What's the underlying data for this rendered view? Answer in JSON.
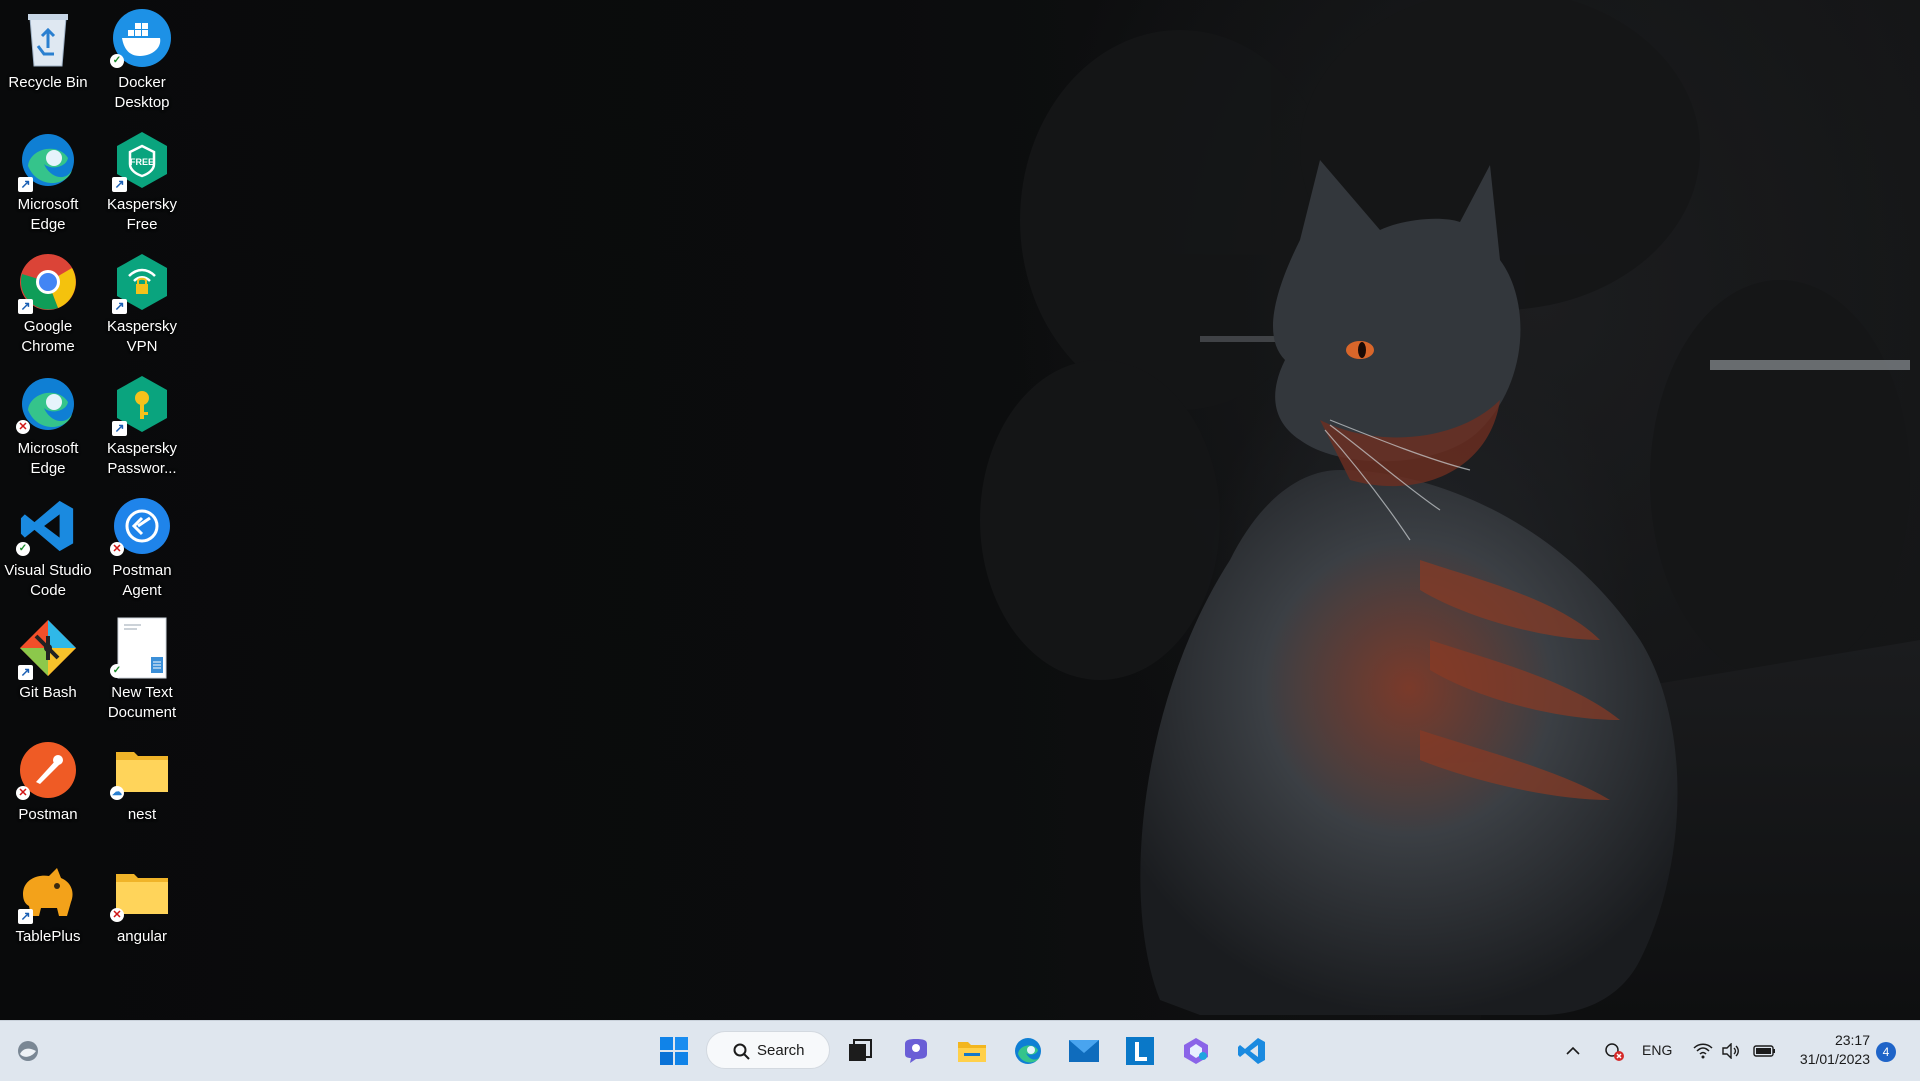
{
  "desktop_icons": [
    {
      "label": "Recycle Bin",
      "icon": "recycle-bin-icon",
      "badge": null
    },
    {
      "label": "Docker Desktop",
      "icon": "docker-icon",
      "badge": "ok"
    },
    {
      "label": "Microsoft Edge",
      "icon": "edge-icon",
      "badge": "shortcut"
    },
    {
      "label": "Kaspersky Free",
      "icon": "kaspersky-free-icon",
      "badge": "shortcut"
    },
    {
      "label": "Google Chrome",
      "icon": "chrome-icon",
      "badge": "shortcut"
    },
    {
      "label": "Kaspersky VPN",
      "icon": "kaspersky-vpn-icon",
      "badge": "shortcut"
    },
    {
      "label": "Microsoft Edge",
      "icon": "edge-icon",
      "badge": "error"
    },
    {
      "label": "Kaspersky Passwor...",
      "icon": "kaspersky-password-icon",
      "badge": "shortcut"
    },
    {
      "label": "Visual Studio Code",
      "icon": "vscode-icon",
      "badge": "ok"
    },
    {
      "label": "Postman Agent",
      "icon": "postman-agent-icon",
      "badge": "error"
    },
    {
      "label": "Git Bash",
      "icon": "git-bash-icon",
      "badge": "shortcut"
    },
    {
      "label": "New Text Document",
      "icon": "text-document-icon",
      "badge": "ok"
    },
    {
      "label": "Postman",
      "icon": "postman-icon",
      "badge": "error"
    },
    {
      "label": "nest",
      "icon": "folder-icon",
      "badge": "cloud"
    },
    {
      "label": "TablePlus",
      "icon": "tableplus-icon",
      "badge": "shortcut"
    },
    {
      "label": "angular",
      "icon": "folder-icon",
      "badge": "error"
    }
  ],
  "taskbar": {
    "widgets_icon": "weather-widget-icon",
    "start_icon": "windows-start-icon",
    "search_label": "Search",
    "search_icon": "search-icon",
    "pinned": [
      {
        "name": "task-view",
        "icon": "task-view-icon"
      },
      {
        "name": "teams-chat",
        "icon": "chat-icon"
      },
      {
        "name": "file-explorer",
        "icon": "file-explorer-icon"
      },
      {
        "name": "edge",
        "icon": "edge-icon"
      },
      {
        "name": "mail",
        "icon": "mail-icon"
      },
      {
        "name": "l-app",
        "icon": "l-app-icon"
      },
      {
        "name": "copilot",
        "icon": "copilot-icon"
      },
      {
        "name": "vscode",
        "icon": "vscode-icon"
      }
    ],
    "tray": {
      "language": "ENG",
      "time": "23:17",
      "date": "31/01/2023",
      "notification_count": "4"
    }
  }
}
